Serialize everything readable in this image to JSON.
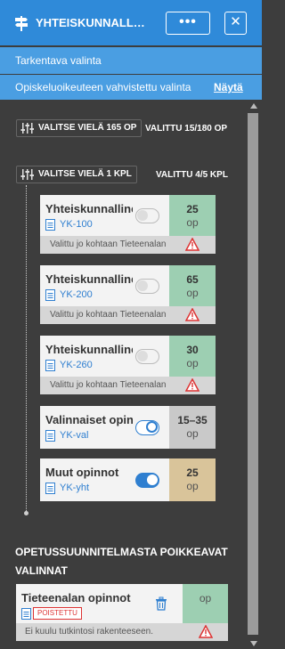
{
  "header": {
    "title": "YHTEISKUNNALLISE...",
    "more_label": "•••",
    "close_label": "✕",
    "signpost_icon": "signpost-icon"
  },
  "subheader": {
    "refining_selection": "Tarkentava valinta",
    "confirmed_selection": "Opiskeluoikeuteen vahvistettu valinta",
    "show_link": "Näytä"
  },
  "filters": {
    "top": {
      "label": "VALITSE VIELÄ 165 OP",
      "selected": "VALITTU 15/180 OP"
    },
    "sub": {
      "label": "VALITSE VIELÄ 1 KPL",
      "selected": "VALITTU 4/5 KPL"
    }
  },
  "cards": [
    {
      "name": "Yhteiskunnallinen",
      "code": "YK-100",
      "credits": "25",
      "unit": "op",
      "toggle": "off",
      "warning": "Valittu jo kohtaan Tieteenalan opinnot"
    },
    {
      "name": "Yhteiskunnallinen",
      "code": "YK-200",
      "credits": "65",
      "unit": "op",
      "toggle": "off",
      "warning": "Valittu jo kohtaan Tieteenalan opinnot"
    },
    {
      "name": "Yhteiskunnallinen",
      "code": "YK-260",
      "credits": "30",
      "unit": "op",
      "toggle": "off",
      "warning": "Valittu jo kohtaan Tieteenalan opinnot"
    },
    {
      "name": "Valinnaiset opinnot",
      "code": "YK-val",
      "credits": "15–35",
      "unit": "op",
      "toggle": "outline-on"
    },
    {
      "name": "Muut opinnot",
      "code": "YK-yht",
      "credits": "25",
      "unit": "op",
      "toggle": "on"
    }
  ],
  "deviating": {
    "title": "OPETUSSUUNNITELMASTA POIKKEAVAT VALINNAT",
    "card": {
      "name": "Tieteenalan opinnot",
      "badge": "POISTETTU",
      "credits": "",
      "unit": "op",
      "warning": "Ei kuulu tutkintosi rakenteeseen."
    }
  },
  "colors": {
    "header_bg": "#2f8ad9",
    "subheader_bg": "#4a9ee2",
    "panel_bg": "#3d3d3d",
    "credits_green": "#9dcfb2",
    "credits_grey": "#c9c9c9",
    "credits_tan": "#d9c49a",
    "link_blue": "#2f7fd0",
    "removed_red": "#d33333"
  }
}
